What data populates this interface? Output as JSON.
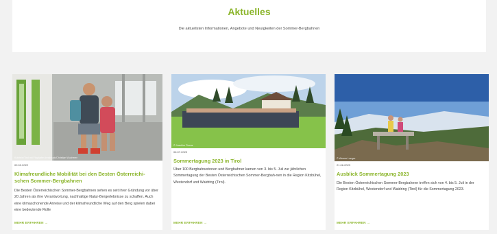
{
  "header": {
    "title": "Aktuelles",
    "subtitle": "Die aktuellsten Informationen, Angebote und Neuigkeiten der Sommer-Bergbahnen"
  },
  "colors": {
    "accent": "#8bb52b",
    "background": "#f2f2f2"
  },
  "cards": [
    {
      "credit": "Kufstein/Tirol mit Flughafen Innsbruck/Christian Wucherer",
      "date": "09.09.2022",
      "title": "Klimafreundliche Mobilität bei den Besten Österreichi-schen Sommer-Bergbahnen",
      "text": "Die Besten Österreichischen Sommer-Bergbahnen sehen es seit ihrer Gründung vor über 20 Jahren als ihre Verantwortung, nachhaltige Natur-Bergerlebnisse zu schaffen. Auch eine klimaschonende Anreise und der klimafreundliche Weg auf den Berg spielen dabei eine bedeutende Rolle",
      "more": "MEHR ERFAHREN →"
    },
    {
      "credit": "© Joachim Fiscus",
      "date": "06.07.2023",
      "title": "Sommertagung 2023 in Tirol",
      "text": "Über 100 Bergbahnerinnen und Bergbahner kamen von 3. bis 5. Juli zur jährlichen Sommertagung der Besten Österreichischen Sommer-Bergbah-nen in die Region Kitzbühel, Westendorf und Waidring (Tirol).",
      "more": "MEHR ERFAHREN →"
    },
    {
      "credit": "© Werner Langer",
      "date": "21.06.2023",
      "title": "Ausblick Sommertagung 2023",
      "text": "Die Besten Österreichischen Sommer-Bergbahnen treffen sich von 4. bis 5. Juli in der Region Kitzbühel, Westendorf und Waidring (Tirol) für die Sommertagung 2023.",
      "more": "MEHR ERFAHREN →"
    }
  ]
}
